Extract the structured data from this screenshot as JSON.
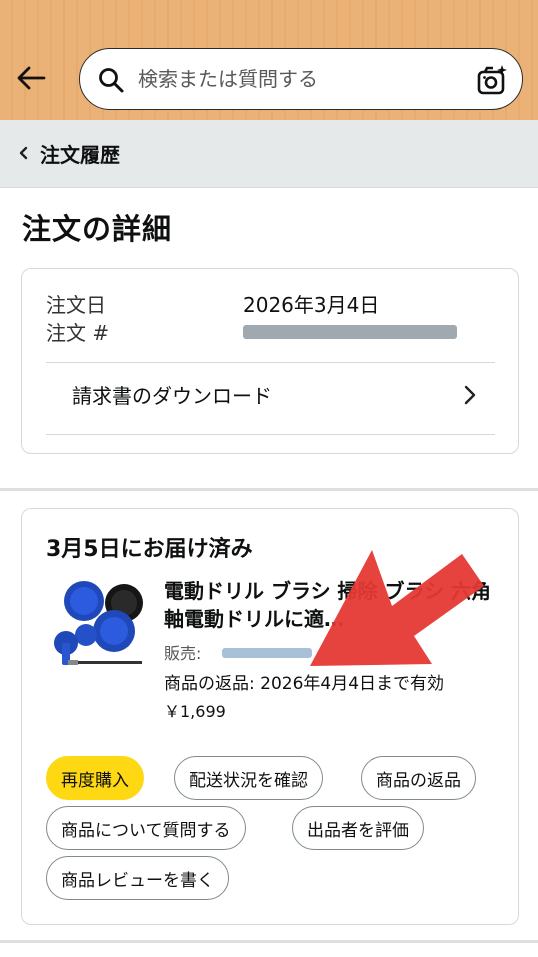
{
  "search": {
    "placeholder": "検索または質問する"
  },
  "breadcrumb": {
    "label": "注文履歴"
  },
  "page": {
    "title": "注文の詳細"
  },
  "order": {
    "date_label": "注文日",
    "date_value": "2026年3月4日",
    "number_label": "注文 #",
    "invoice_label": "請求書のダウンロード"
  },
  "delivery": {
    "status": "3月5日にお届け済み",
    "product_title": "電動ドリル ブラシ 掃除 ブラシ 六角軸電動ドリルに適…",
    "seller_label": "販売:",
    "return_info": "商品の返品: 2026年4月4日まで有効",
    "price": "￥1,699"
  },
  "actions": {
    "buy_again": "再度購入",
    "track": "配送状況を確認",
    "return": "商品の返品",
    "ask": "商品について質問する",
    "rate_seller": "出品者を評価",
    "review": "商品レビューを書く"
  },
  "colors": {
    "accent": "#ffd814",
    "header": "#ebb277",
    "annotation_arrow": "#e53935"
  }
}
